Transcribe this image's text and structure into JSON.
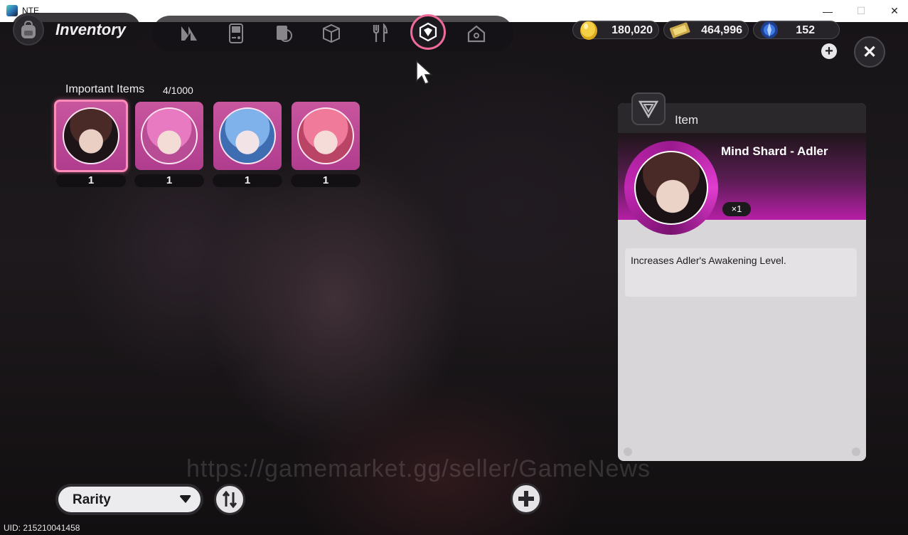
{
  "window": {
    "title": "NTE",
    "min_glyph": "—",
    "max_glyph": "☐",
    "close_glyph": "✕"
  },
  "header": {
    "title": "Inventory"
  },
  "tabs": [
    {
      "icon": "n-logo-icon"
    },
    {
      "icon": "gameboy-icon"
    },
    {
      "icon": "book-icon"
    },
    {
      "icon": "box-icon"
    },
    {
      "icon": "fork-knife-icon"
    },
    {
      "icon": "gem-box-icon",
      "active": true
    },
    {
      "icon": "home-icon"
    }
  ],
  "currencies": [
    {
      "icon": "gold-coin-icon",
      "value": "180,020"
    },
    {
      "icon": "ticket-icon",
      "value": "464,996"
    },
    {
      "icon": "crystal-icon",
      "value": "152"
    }
  ],
  "plus_glyph": "+",
  "close_glyph": "✕",
  "section": {
    "title": "Important Items",
    "count": "4/1000"
  },
  "items": [
    {
      "portrait": "dark-hair-man",
      "qty": "1",
      "selected": true
    },
    {
      "portrait": "pink-hair-girl",
      "qty": "1"
    },
    {
      "portrait": "blue-hair-girl",
      "qty": "1"
    },
    {
      "portrait": "pink-hair-boy",
      "qty": "1"
    }
  ],
  "detail": {
    "type_label": "Item",
    "name": "Mind Shard - Adler",
    "quantity": "×1",
    "description": "Increases Adler's Awakening Level."
  },
  "sort": {
    "label": "Rarity"
  },
  "watermark": "https://gamemarket.gg/seller/GameNews",
  "uid": "UID: 215210041458",
  "colors": {
    "accent_pink": "#f06a9a",
    "rarity_purple": "#b03c8e",
    "banner_magenta": "#b61ea6"
  }
}
